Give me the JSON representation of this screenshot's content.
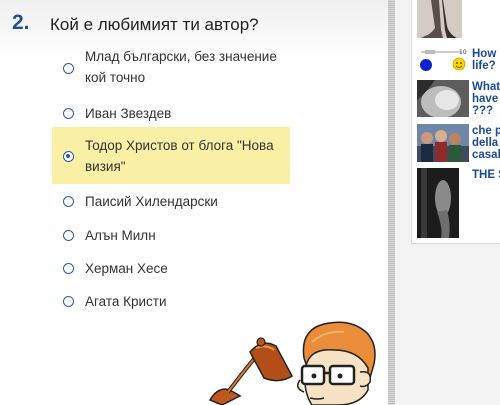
{
  "quiz": {
    "question_number": "2.",
    "question_text": "Кой е любимият ти автор?",
    "options": [
      {
        "line1": "Млад български, без значение",
        "line2": "кой точно",
        "selected": false
      },
      {
        "line1": "Иван Звездев",
        "line2": "",
        "selected": false
      },
      {
        "line1": "Тодор Христов от блога \"Нова",
        "line2": "визия\"",
        "selected": true
      },
      {
        "line1": "Паисий Хилендарски",
        "line2": "",
        "selected": false
      },
      {
        "line1": "Алън Милн",
        "line2": "",
        "selected": false
      },
      {
        "line1": "Херман Хесе",
        "line2": "",
        "selected": false
      },
      {
        "line1": "Агата Кристи",
        "line2": "",
        "selected": false
      }
    ]
  },
  "sidebar": {
    "links": [
      {
        "line1": "How",
        "line2": "life?",
        "line3": ""
      },
      {
        "line1": "What",
        "line2": "have",
        "line3": "???"
      },
      {
        "line1": "che p",
        "line2": "della",
        "line3": "casal"
      },
      {
        "line1": "THE S",
        "line2": "",
        "line3": ""
      }
    ]
  },
  "colors": {
    "accent": "#1f4f97",
    "selected_bg": "#faf0a5",
    "link": "#1a4a99"
  }
}
